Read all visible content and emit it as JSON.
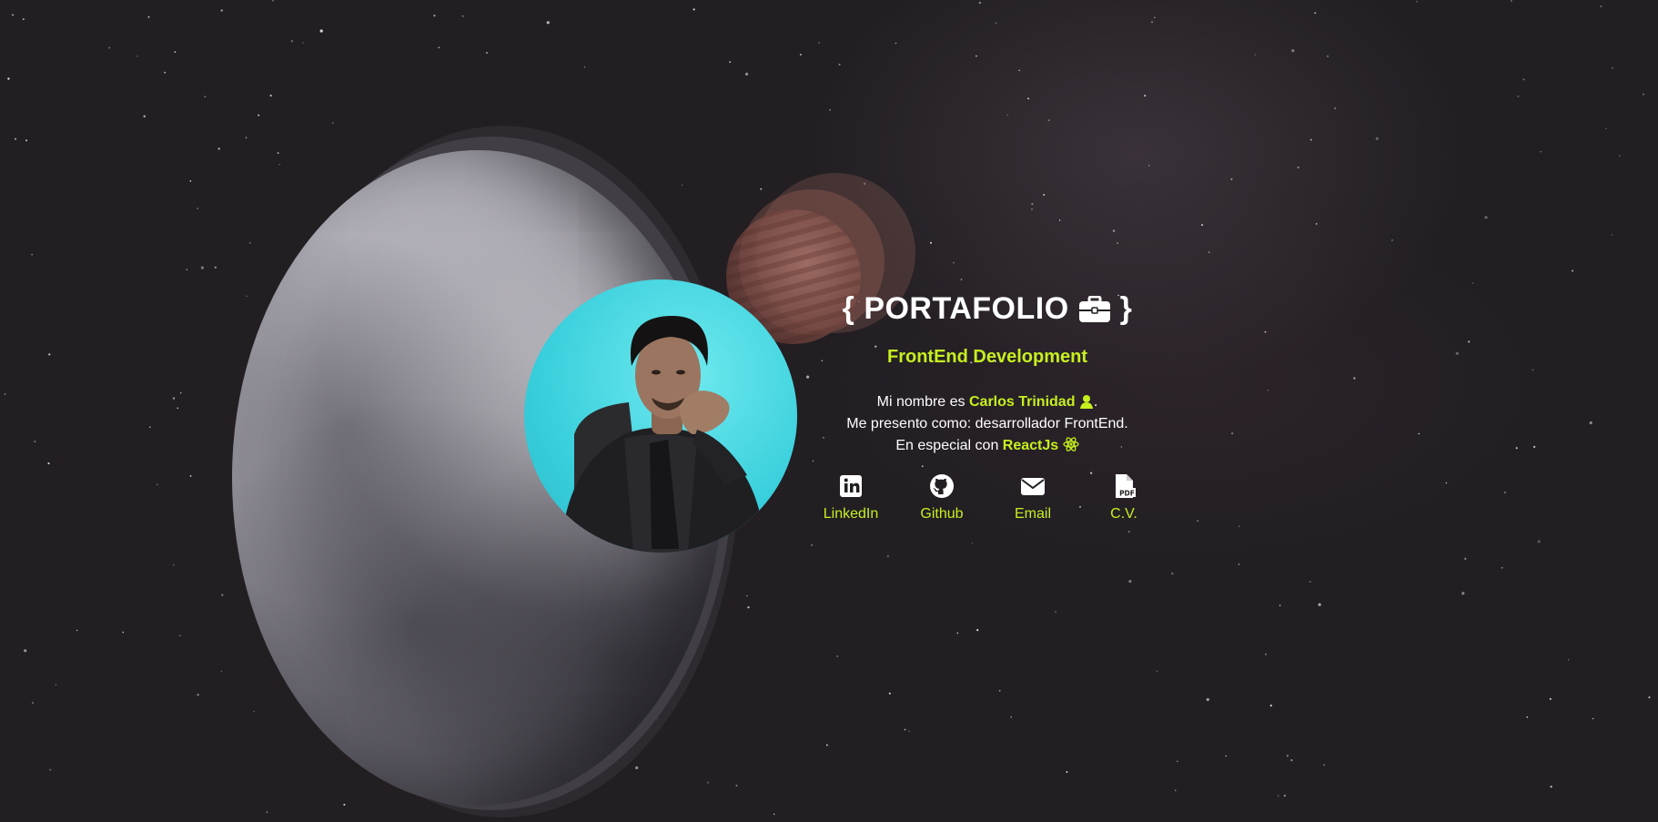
{
  "header": {
    "title": "PORTAFOLIO",
    "brace_open": "{",
    "brace_close": "}",
    "title_icon": "briefcase-icon"
  },
  "subtitle": "FrontEnd Development",
  "bio": {
    "line1_prefix": "Mi nombre es",
    "name": "Carlos Trinidad",
    "name_icon": "user-icon",
    "line1_suffix": ".",
    "line2": "Me presento como: desarrollador FrontEnd.",
    "line3_prefix": "En especial con",
    "tech": "ReactJs",
    "tech_icon": "react-atom-icon"
  },
  "links": [
    {
      "label": "LinkedIn",
      "icon": "linkedin-icon"
    },
    {
      "label": "Github",
      "icon": "github-icon"
    },
    {
      "label": "Email",
      "icon": "envelope-icon"
    },
    {
      "label": "C.V.",
      "icon": "pdf-file-icon"
    }
  ],
  "colors": {
    "accent": "#c6ef1f",
    "text": "#ffffff",
    "background": "#221e22",
    "avatar_background": "#39cfdc"
  }
}
